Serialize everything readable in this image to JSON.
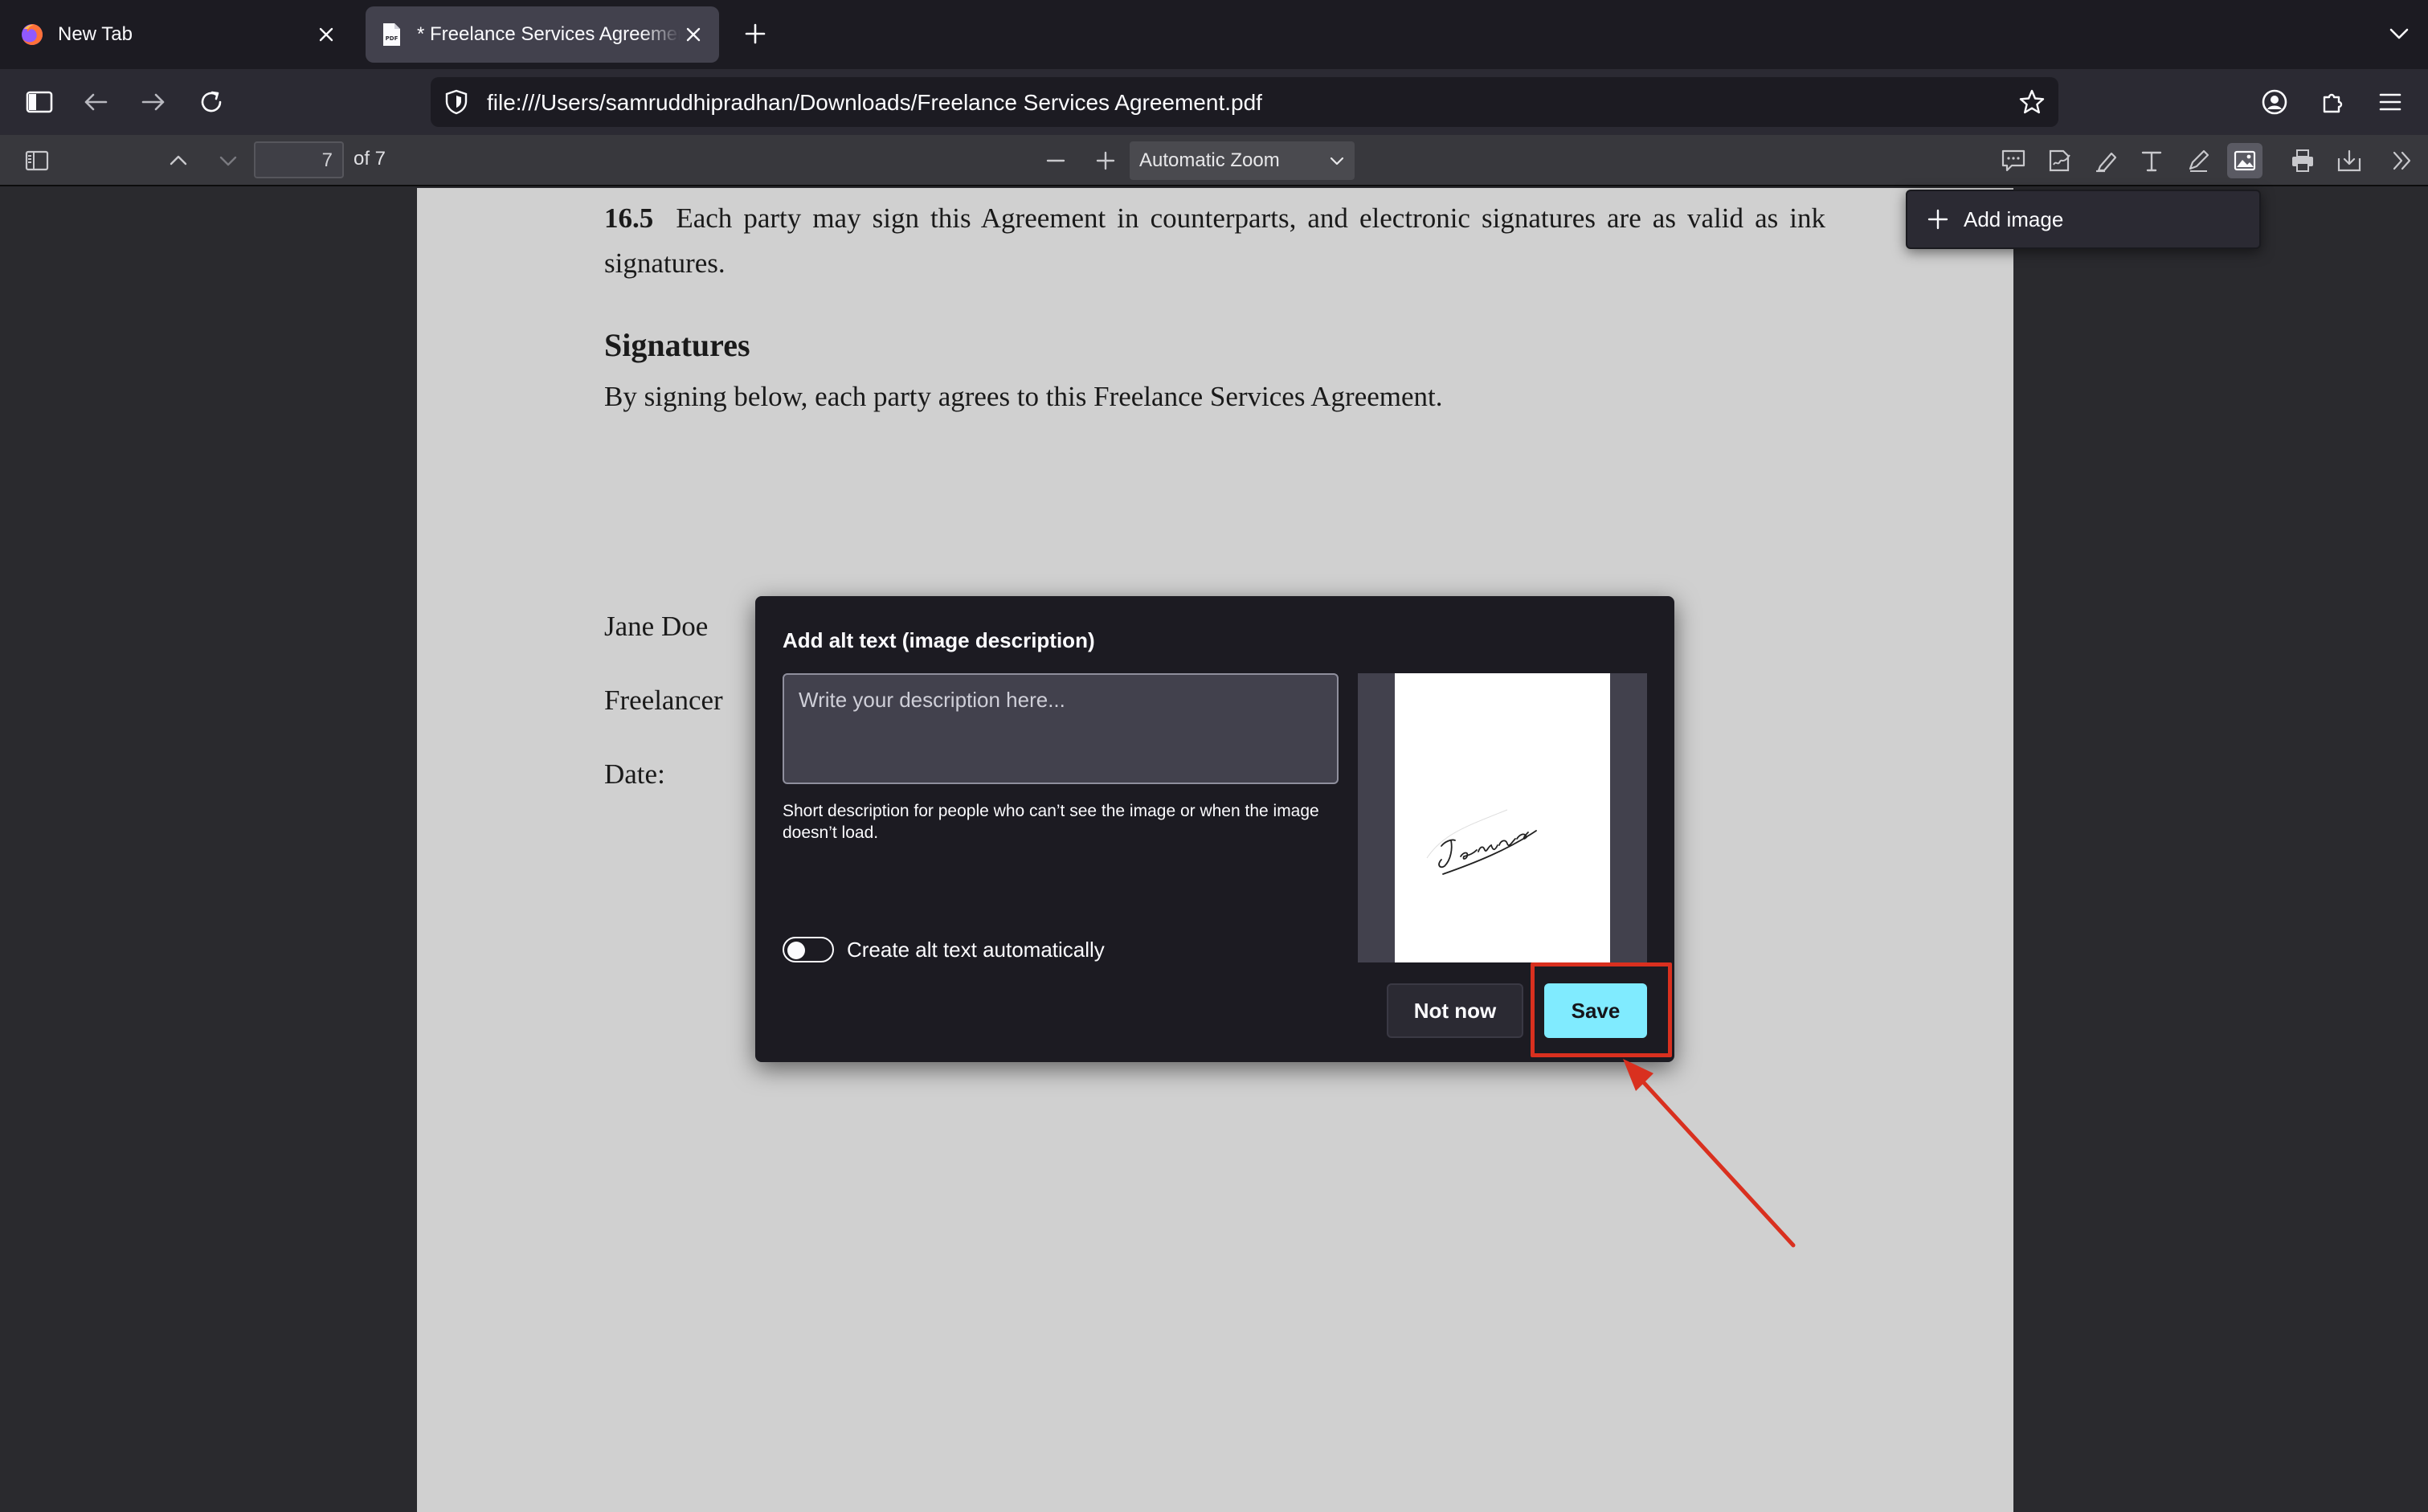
{
  "tabs": [
    {
      "title": "New Tab",
      "icon": "firefox-icon"
    },
    {
      "title": "* Freelance Services Agreement.pdf",
      "icon": "pdf-file-icon",
      "active": true
    }
  ],
  "navbar": {
    "url": "file:///Users/samruddhipradhan/Downloads/Freelance Services Agreement.pdf"
  },
  "pdf_toolbar": {
    "page_number": "7",
    "page_count": "of 7",
    "zoom": "Automatic Zoom"
  },
  "add_image_popup": {
    "label": "Add image"
  },
  "document": {
    "clause_number": "16.5",
    "clause_text": "Each party may sign this Agreement in counterparts, and electronic signatures are as valid as ink signatures.",
    "signatures_heading": "Signatures",
    "signatures_intro": "By signing below, each party agrees to this Freelance Services Agreement.",
    "name": "Jane Doe",
    "role": "Freelancer",
    "date_label": "Date:"
  },
  "alt_text_dialog": {
    "title": "Add alt text (image description)",
    "placeholder": "Write your description here...",
    "help_text": "Short description for people who can’t see the image or when the image doesn’t load.",
    "toggle_label": "Create alt text automatically",
    "toggle_on": false,
    "not_now_label": "Not now",
    "save_label": "Save",
    "signature_text": "Jenna"
  },
  "colors": {
    "save_button": "#80ebff",
    "annotation_red": "#d9301f",
    "page_background": "#d0d0d0"
  }
}
